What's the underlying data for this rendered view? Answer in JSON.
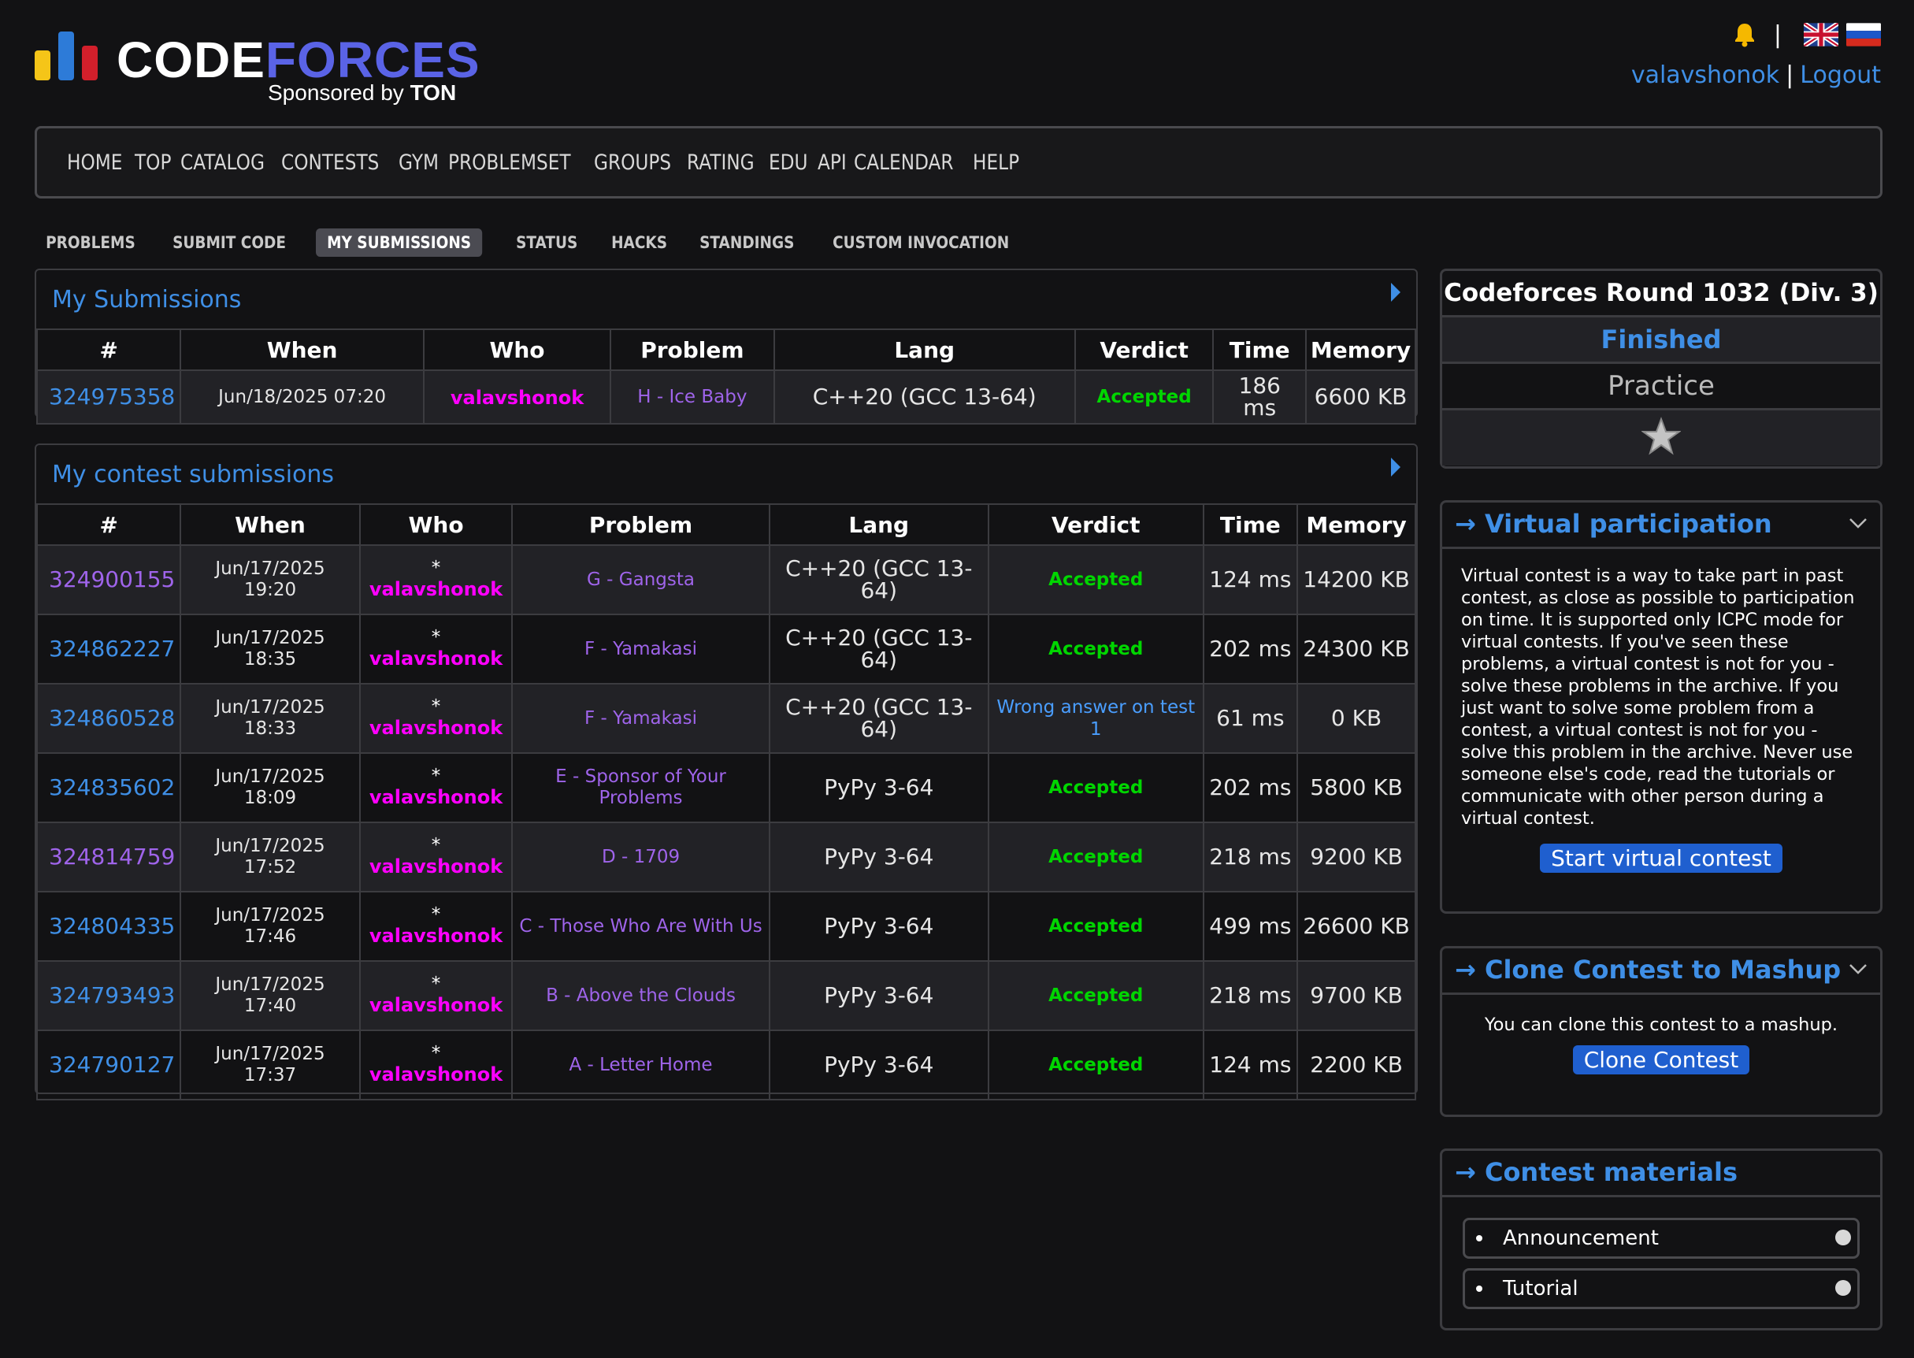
{
  "logo": {
    "word_part1": "CODE",
    "word_part2": "FORCES",
    "sponsor_prefix": "Sponsored by ",
    "sponsor_name": "TON"
  },
  "header": {
    "username": "valavshonok",
    "logout": "Logout",
    "separator": "|"
  },
  "main_menu": [
    "HOME",
    "TOP",
    "CATALOG",
    "CONTESTS",
    "GYM",
    "PROBLEMSET",
    "GROUPS",
    "RATING",
    "EDU",
    "API",
    "CALENDAR",
    "HELP"
  ],
  "sub_menu": [
    {
      "label": "PROBLEMS",
      "active": false
    },
    {
      "label": "SUBMIT CODE",
      "active": false
    },
    {
      "label": "MY SUBMISSIONS",
      "active": true
    },
    {
      "label": "STATUS",
      "active": false
    },
    {
      "label": "HACKS",
      "active": false
    },
    {
      "label": "STANDINGS",
      "active": false
    },
    {
      "label": "CUSTOM INVOCATION",
      "active": false
    }
  ],
  "my_submissions": {
    "title": "My Submissions",
    "headers": [
      "#",
      "When",
      "Who",
      "Problem",
      "Lang",
      "Verdict",
      "Time",
      "Memory"
    ],
    "rows": [
      {
        "id": "324975358",
        "when": "Jun/18/2025 07:20",
        "who": "valavshonok",
        "problem": "H - Ice Baby",
        "lang": "C++20 (GCC 13-64)",
        "verdict": "Accepted",
        "time": "186 ms",
        "memory": "6600 KB"
      }
    ]
  },
  "contest_submissions": {
    "title": "My contest submissions",
    "headers": [
      "#",
      "When",
      "Who",
      "Problem",
      "Lang",
      "Verdict",
      "Time",
      "Memory"
    ],
    "rows": [
      {
        "id": "324900155",
        "when_date": "Jun/17/2025",
        "when_time": "19:20",
        "who_prefix": "*",
        "who": "valavshonok",
        "problem": "G - Gangsta",
        "lang": "C++20 (GCC 13-64)",
        "verdict": "Accepted",
        "time": "124 ms",
        "memory": "14200 KB",
        "id_color": "violet"
      },
      {
        "id": "324862227",
        "when_date": "Jun/17/2025",
        "when_time": "18:35",
        "who_prefix": "*",
        "who": "valavshonok",
        "problem": "F - Yamakasi",
        "lang": "C++20 (GCC 13-64)",
        "verdict": "Accepted",
        "time": "202 ms",
        "memory": "24300 KB",
        "id_color": "blue"
      },
      {
        "id": "324860528",
        "when_date": "Jun/17/2025",
        "when_time": "18:33",
        "who_prefix": "*",
        "who": "valavshonok",
        "problem": "F - Yamakasi",
        "lang": "C++20 (GCC 13-64)",
        "verdict": "Wrong answer on test 1",
        "time": "61 ms",
        "memory": "0 KB",
        "id_color": "blue"
      },
      {
        "id": "324835602",
        "when_date": "Jun/17/2025",
        "when_time": "18:09",
        "who_prefix": "*",
        "who": "valavshonok",
        "problem": "E - Sponsor of Your Problems",
        "lang": "PyPy 3-64",
        "verdict": "Accepted",
        "time": "202 ms",
        "memory": "5800 KB",
        "id_color": "blue"
      },
      {
        "id": "324814759",
        "when_date": "Jun/17/2025",
        "when_time": "17:52",
        "who_prefix": "*",
        "who": "valavshonok",
        "problem": "D - 1709",
        "lang": "PyPy 3-64",
        "verdict": "Accepted",
        "time": "218 ms",
        "memory": "9200 KB",
        "id_color": "violet"
      },
      {
        "id": "324804335",
        "when_date": "Jun/17/2025",
        "when_time": "17:46",
        "who_prefix": "*",
        "who": "valavshonok",
        "problem": "C - Those Who Are With Us",
        "lang": "PyPy 3-64",
        "verdict": "Accepted",
        "time": "499 ms",
        "memory": "26600 KB",
        "id_color": "blue"
      },
      {
        "id": "324793493",
        "when_date": "Jun/17/2025",
        "when_time": "17:40",
        "who_prefix": "*",
        "who": "valavshonok",
        "problem": "B - Above the Clouds",
        "lang": "PyPy 3-64",
        "verdict": "Accepted",
        "time": "218 ms",
        "memory": "9700 KB",
        "id_color": "blue"
      },
      {
        "id": "324790127",
        "when_date": "Jun/17/2025",
        "when_time": "17:37",
        "who_prefix": "*",
        "who": "valavshonok",
        "problem": "A - Letter Home",
        "lang": "PyPy 3-64",
        "verdict": "Accepted",
        "time": "124 ms",
        "memory": "2200 KB",
        "id_color": "blue"
      }
    ]
  },
  "contest_box": {
    "name": "Codeforces Round 1032 (Div. 3)",
    "status": "Finished",
    "mode": "Practice"
  },
  "virtual": {
    "title": "→ Virtual participation",
    "text": "Virtual contest is a way to take part in past contest, as close as possible to participation on time. It is supported only ICPC mode for virtual contests. If you've seen these problems, a virtual contest is not for you - solve these problems in the archive. If you just want to solve some problem from a contest, a virtual contest is not for you - solve this problem in the archive. Never use someone else's code, read the tutorials or communicate with other person during a virtual contest.",
    "button": "Start virtual contest"
  },
  "clone": {
    "title": "→ Clone Contest to Mashup",
    "text": "You can clone this contest to a mashup.",
    "button": "Clone Contest"
  },
  "materials": {
    "title": "→ Contest materials",
    "items": [
      "Announcement",
      "Tutorial"
    ]
  },
  "colors": {
    "link_blue": "#3f8fe6",
    "link_violet": "#9f64ea",
    "user_magenta": "#ff00ff",
    "accepted_green": "#00d600",
    "button_blue": "#1f5fcf"
  }
}
